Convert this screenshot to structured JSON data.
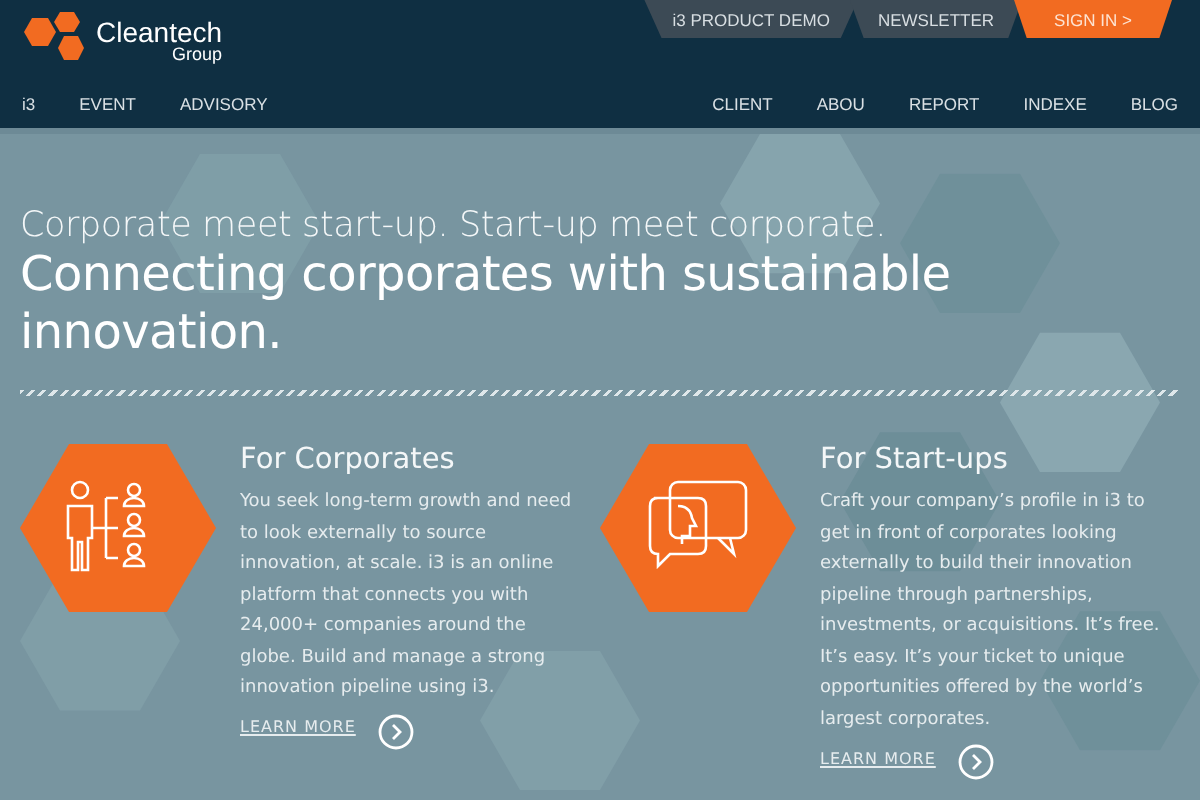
{
  "logo": {
    "name": "Cleantech",
    "sub": "Group"
  },
  "top_links": [
    {
      "label": "i3 PRODUCT DEMO",
      "kind": "dark"
    },
    {
      "label": "NEWSLETTER",
      "kind": "dark"
    },
    {
      "label": "SIGN IN >",
      "kind": "accent"
    }
  ],
  "nav_left": [
    "i3",
    "EVENT",
    "ADVISORY"
  ],
  "nav_right": [
    "CLIENT",
    "ABOU",
    "REPORT",
    "INDEXE",
    "BLOG"
  ],
  "hero": {
    "tagline": "Corporate meet start-up. Start-up meet corporate.",
    "headline": "Connecting corporates with sustainable innovation."
  },
  "features": [
    {
      "kind": "corporates",
      "title": "For Corporates",
      "body": "You seek long-term growth and need to look externally to source innovation, at scale. i3 is an online platform that connects you with 24,000+ companies around the globe. Build and manage a strong innovation pipeline using i3.",
      "link": "LEARN MORE"
    },
    {
      "kind": "startups",
      "title": "For Start-ups",
      "body": "Craft your company’s profile in i3 to get in front of corporates looking externally to build their innovation pipeline through partnerships, investments, or acquisitions.  It’s free. It’s easy. It’s your ticket to unique opportunities offered by the world’s largest corporates.",
      "link": "LEARN MORE"
    }
  ]
}
